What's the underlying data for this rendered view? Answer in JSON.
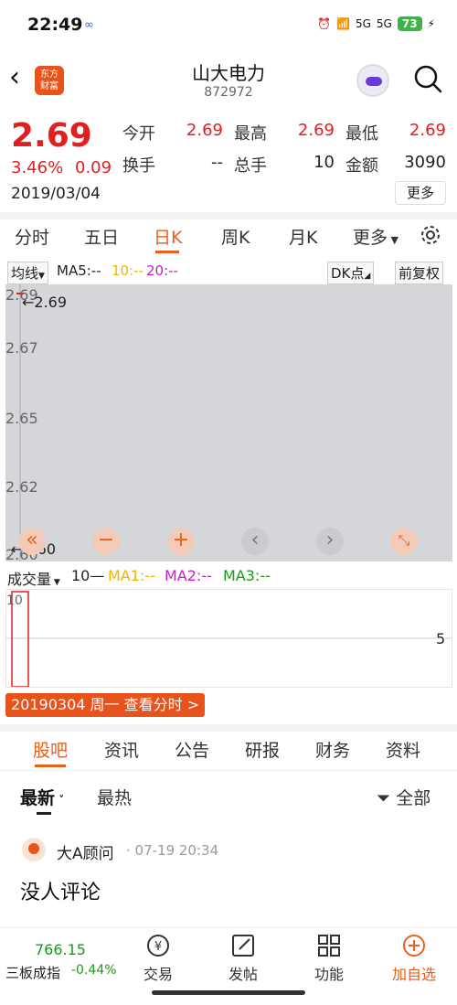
{
  "status_bar": {
    "time": "22:49",
    "battery": "73",
    "net1": "5G",
    "net2": "5G"
  },
  "header": {
    "title": "山大电力",
    "code": "872972",
    "logo_top": "东方",
    "logo_bottom": "财富"
  },
  "quote": {
    "price": "2.69",
    "change_pct": "3.46%",
    "change_val": "0.09",
    "date": "2019/03/04",
    "fields": [
      {
        "label": "今开",
        "value": "2.69"
      },
      {
        "label": "最高",
        "value": "2.69"
      },
      {
        "label": "最低",
        "value": "2.69"
      },
      {
        "label": "换手",
        "value": "--"
      },
      {
        "label": "总手",
        "value": "10"
      },
      {
        "label": "金额",
        "value": "3090"
      }
    ],
    "more_label": "更多"
  },
  "chart_tabs": [
    "分时",
    "五日",
    "日K",
    "周K",
    "月K",
    "更多"
  ],
  "active_chart_tab": "日K",
  "ma_bar": {
    "selector": "均线",
    "ma5": "MA5:--",
    "ma10": "10:--",
    "ma20": "20:--",
    "dk": "DK点",
    "adjust": "前复权"
  },
  "price_chart": {
    "y_ticks": [
      "2.69",
      "2.67",
      "2.65",
      "2.62",
      "2.60"
    ],
    "high_label": "←2.69",
    "low_label": "←2.60",
    "controls": [
      "«",
      "−",
      "+",
      "‹",
      "›",
      "⤡"
    ]
  },
  "volume_bar": {
    "selector": "成交量",
    "ten": "10",
    "ma1": "MA1:--",
    "ma2": "MA2:--",
    "ma3": "MA3:--"
  },
  "volume_chart": {
    "top_tick": "10",
    "right_tick": "5"
  },
  "tip": "20190304 周一 查看分时 >",
  "bottom_tabs": [
    "股吧",
    "资讯",
    "公告",
    "研报",
    "财务",
    "资料"
  ],
  "active_bottom_tab": "股吧",
  "feed_tabs": {
    "latest": "最新",
    "hot": "最热",
    "filter": "全部"
  },
  "post": {
    "user": "大A顾问",
    "time": "· 07-19 20:34",
    "text": "没人评论"
  },
  "bottom_nav": {
    "index_value": "766.15",
    "index_name": "三板成指",
    "index_change": "-0.44%",
    "items": [
      "交易",
      "发帖",
      "功能",
      "加自选"
    ]
  },
  "colors": {
    "up": "#e02020",
    "accent": "#e8601c",
    "ma10": "#e6b800",
    "ma20": "#c81ec8",
    "ma3": "#1a9a1a",
    "down": "#1a9a1a"
  },
  "chart_data": {
    "type": "candlestick",
    "categories": [
      "20190304"
    ],
    "values": [
      {
        "open": 2.69,
        "high": 2.69,
        "low": 2.69,
        "close": 2.69,
        "volume": 10
      }
    ],
    "ylim": [
      2.6,
      2.69
    ]
  }
}
